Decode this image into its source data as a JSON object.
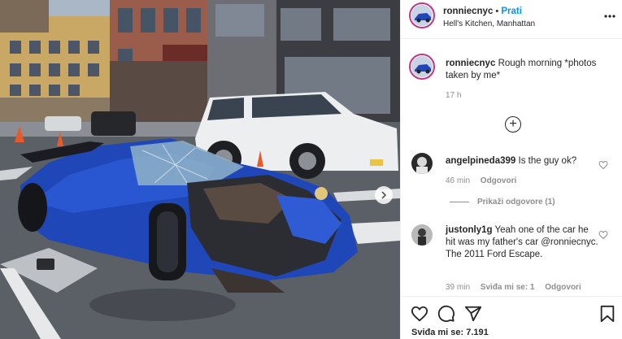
{
  "post": {
    "author": {
      "username": "ronniecnyc",
      "follow_label": "Prati",
      "separator": "•",
      "location": "Hell's Kitchen, Manhattan"
    },
    "caption": {
      "username": "ronniecnyc",
      "text": "Rough morning *photos taken by me*",
      "time": "17 h"
    },
    "comments": [
      {
        "username": "angelpineda399",
        "text": "Is the guy ok?",
        "time": "46 min",
        "reply_label": "Odgovori",
        "view_replies_label": "Prikaži odgovore (1)"
      },
      {
        "username": "justonly1g",
        "text": "Yeah one of the car he hit was my father's car @ronniecnyc. The 2011 Ford Escape.",
        "time": "39 min",
        "likes_label": "Sviđa mi se: 1",
        "reply_label": "Odgovori"
      }
    ],
    "likes_label": "Sviđa mi se: 7.191"
  },
  "icons": {
    "more": "more-horizontal-icon",
    "add_comments": "plus-circle-icon",
    "like": "heart-icon",
    "comment": "comment-icon",
    "share": "share-icon",
    "save": "bookmark-icon",
    "next": "chevron-right-icon"
  },
  "colors": {
    "follow_blue": "#0095f6",
    "meta_gray": "#8e8e8e",
    "text": "#262626",
    "car_blue": "#1f47b8"
  }
}
